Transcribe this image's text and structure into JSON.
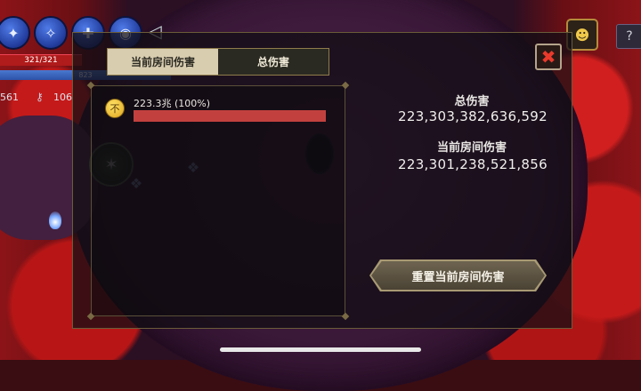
{
  "hud": {
    "hp_text": "321/321",
    "mp_text": "823",
    "gold_count": "561",
    "key_count": "106",
    "skill_icons": [
      "staff-icon",
      "axe-icon",
      "hammer-icon",
      "orb-icon"
    ]
  },
  "tabs": [
    {
      "label": "当前房间伤害",
      "active": true
    },
    {
      "label": "总伤害",
      "active": false
    }
  ],
  "damage_list": [
    {
      "player_icon": "不",
      "value": "223.3兆 (100%)",
      "fraction": 1.0
    }
  ],
  "stats": {
    "total_label": "总伤害",
    "total_value": "223,303,382,636,592",
    "room_label": "当前房间伤害",
    "room_value": "223,301,238,521,856"
  },
  "buttons": {
    "reset_label": "重置当前房间伤害",
    "close_symbol": "✖",
    "help_symbol": "?"
  },
  "colors": {
    "accent_gold": "#b58c3c",
    "damage_bar": "#c2413f",
    "close_red": "#ea3a2c"
  }
}
